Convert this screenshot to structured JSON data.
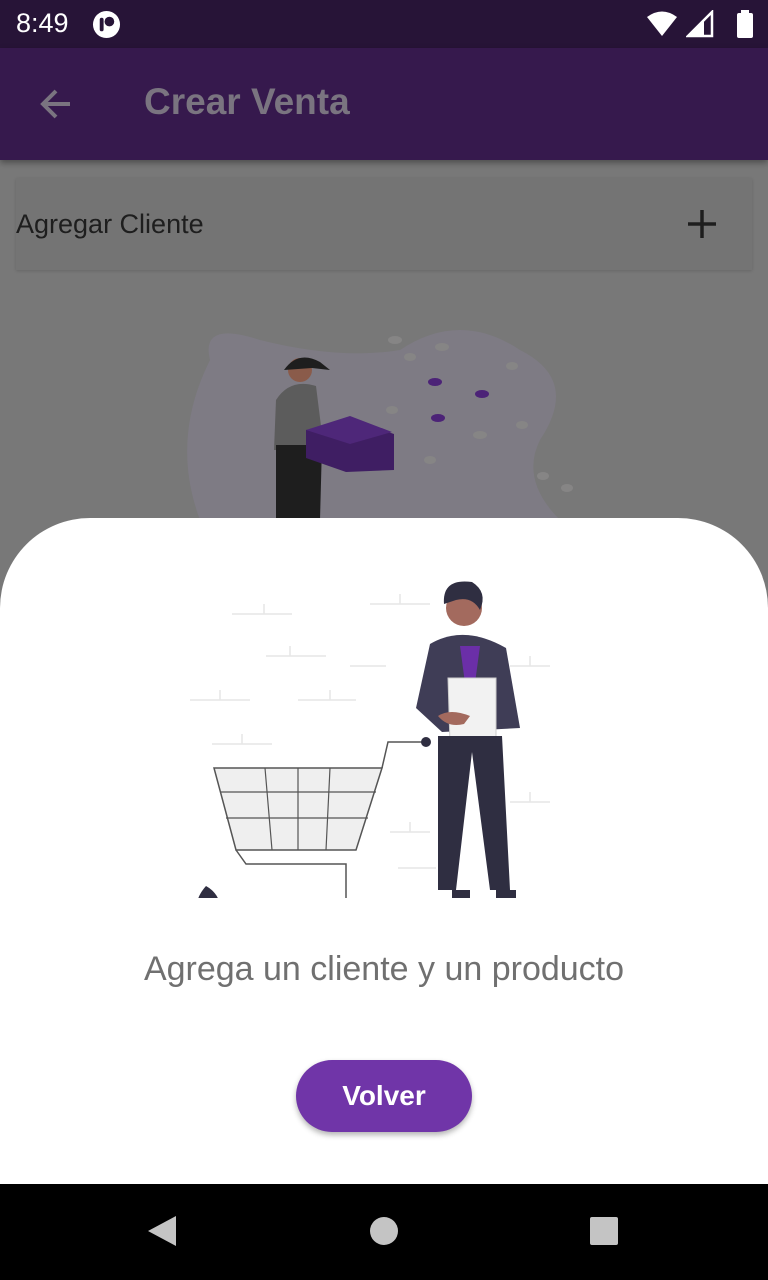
{
  "status_bar": {
    "time": "8:49",
    "icons": [
      "app-notification-icon",
      "wifi-icon",
      "signal-icon",
      "battery-icon"
    ]
  },
  "app_bar": {
    "title": "Crear Venta",
    "back_icon": "arrow-back-icon"
  },
  "client_row": {
    "label": "Agregar Cliente",
    "action_icon": "plus-icon"
  },
  "dialog": {
    "message": "Agrega un cliente y un producto",
    "button_label": "Volver",
    "illustration": "shopping-cart-person-illustration"
  },
  "nav_bar": {
    "icons": [
      "back-triangle-icon",
      "home-circle-icon",
      "recents-square-icon"
    ]
  },
  "colors": {
    "accent": "#7035a8",
    "app_bar": "#36194d",
    "status_bar": "#271437",
    "scrim": "#787878"
  }
}
